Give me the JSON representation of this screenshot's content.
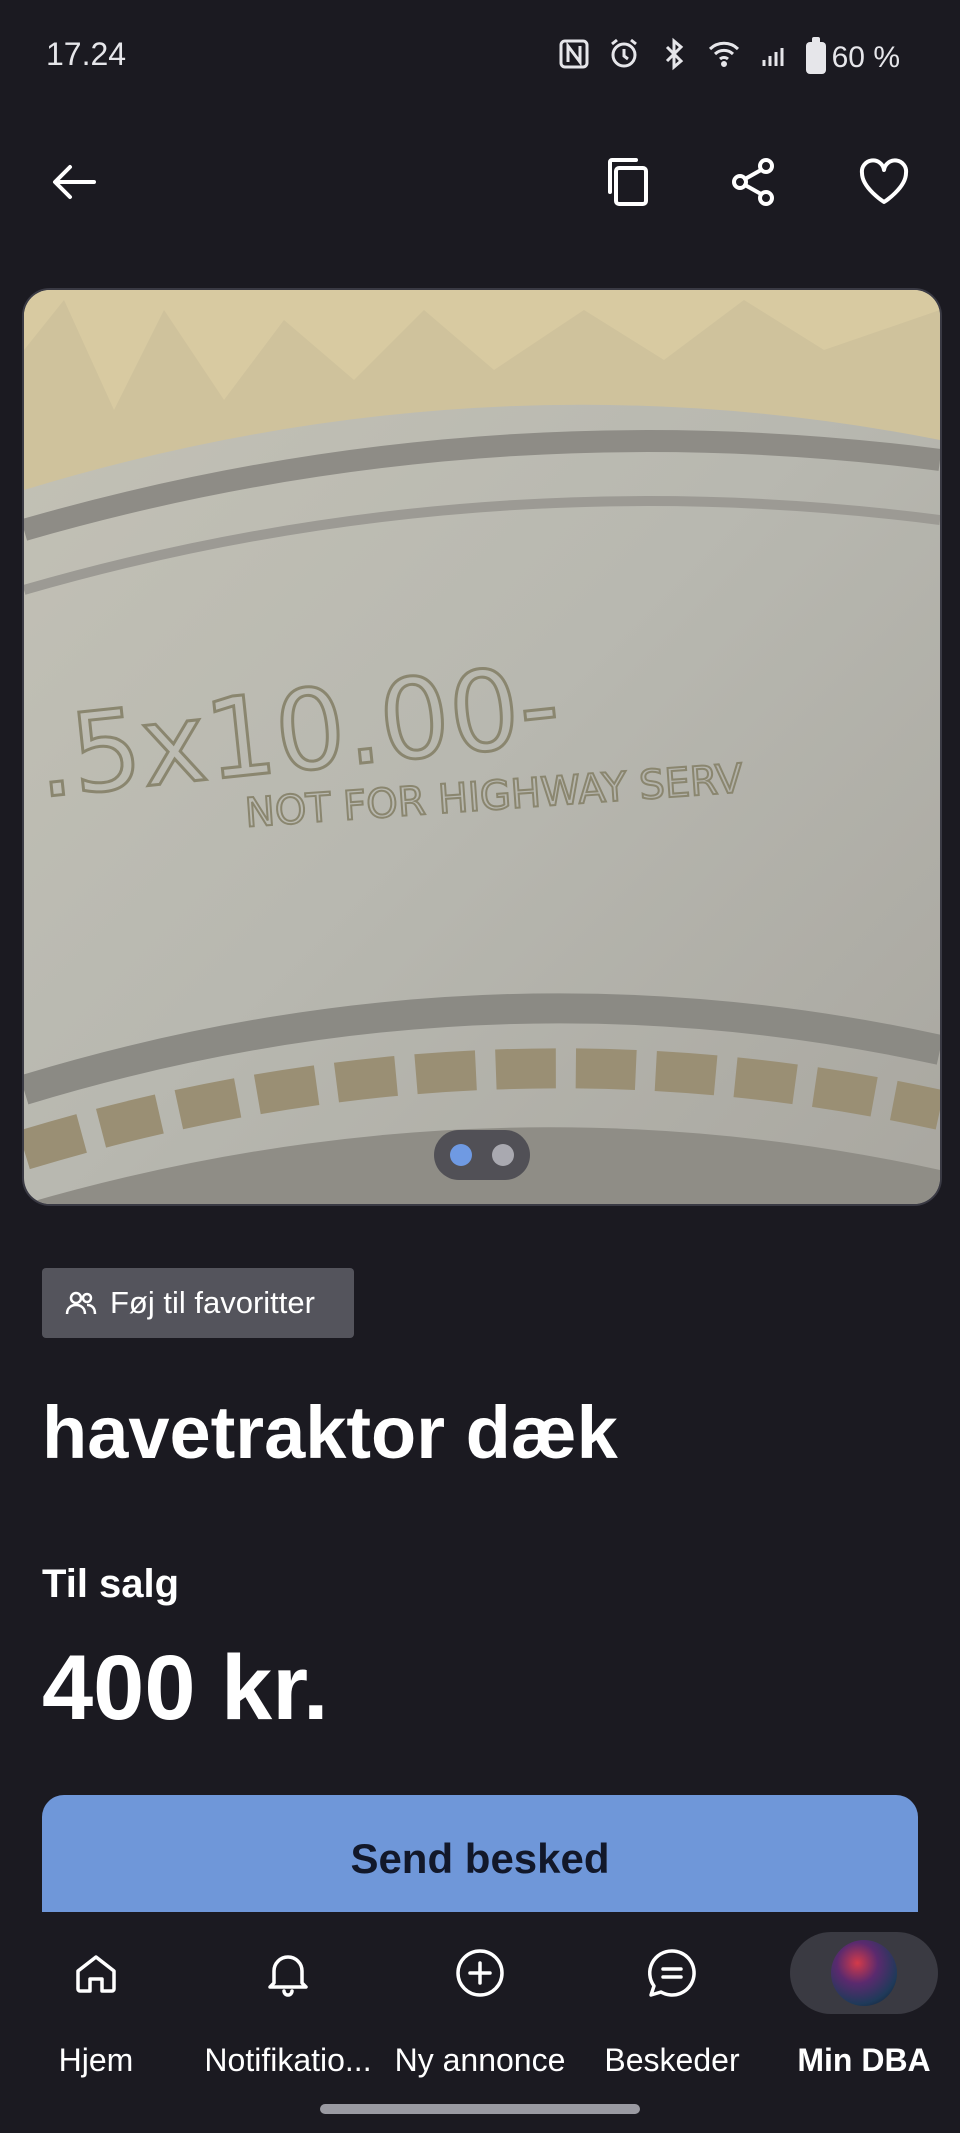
{
  "status_bar": {
    "time": "17.24",
    "battery": "60 %"
  },
  "top_nav": {
    "back_icon": "arrow-left-icon",
    "copy_icon": "copy-icon",
    "share_icon": "share-icon",
    "favorite_icon": "heart-icon"
  },
  "gallery": {
    "total_images": 2,
    "active_index": 0
  },
  "listing": {
    "favorite_tag": "Føj til favoritter",
    "title": "havetraktor dæk",
    "sale_label": "Til salg",
    "price": "400 kr.",
    "send_button": "Send besked"
  },
  "bottom_nav": {
    "items": [
      {
        "label": "Hjem",
        "icon": "home-icon"
      },
      {
        "label": "Notifikatio...",
        "icon": "bell-icon"
      },
      {
        "label": "Ny annonce",
        "icon": "plus-circle-icon"
      },
      {
        "label": "Beskeder",
        "icon": "chat-icon"
      },
      {
        "label": "Min DBA",
        "icon": "avatar"
      }
    ],
    "active": "Min DBA"
  },
  "colors": {
    "background": "#1b1a21",
    "accent": "#6f97d9",
    "tag_background": "#54545c"
  }
}
